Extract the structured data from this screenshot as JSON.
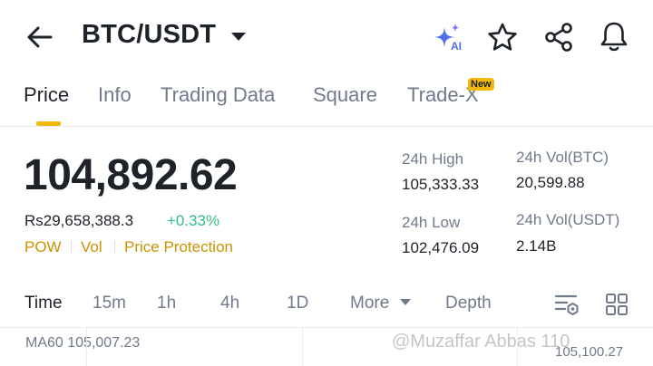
{
  "header": {
    "pair": "BTC/USDT",
    "ai_label": "AI",
    "icons": [
      "back-arrow-icon",
      "ai-sparkle-icon",
      "star-icon",
      "share-icon",
      "bell-icon"
    ]
  },
  "tabs": [
    {
      "label": "Price",
      "active": true
    },
    {
      "label": "Info"
    },
    {
      "label": "Trading Data"
    },
    {
      "label": "Square"
    },
    {
      "label": "Trade-X",
      "badge": "New"
    }
  ],
  "price": {
    "last": "104,892.62",
    "fiat": "Rs29,658,388.3",
    "change": "+0.33%",
    "tags": [
      "POW",
      "Vol",
      "Price Protection"
    ]
  },
  "stats": {
    "high_label": "24h High",
    "high_value": "105,333.33",
    "low_label": "24h Low",
    "low_value": "102,476.09",
    "vol_btc_label": "24h Vol(BTC)",
    "vol_btc_value": "20,599.88",
    "vol_usdt_label": "24h Vol(USDT)",
    "vol_usdt_value": "2.14B"
  },
  "timeframes": {
    "items": [
      "Time",
      "15m",
      "1h",
      "4h",
      "1D",
      "More"
    ],
    "active": "Time",
    "depth": "Depth"
  },
  "chart": {
    "ma60": "MA60 105,007.23",
    "axis_value": "105,100.27",
    "watermark": "@Muzaffar Abbas 110"
  },
  "colors": {
    "accent": "#f0b90b",
    "tag_text": "#c99400",
    "positive": "#2ebd85",
    "primary_text": "#1e2329",
    "secondary_text": "#707a8a"
  }
}
